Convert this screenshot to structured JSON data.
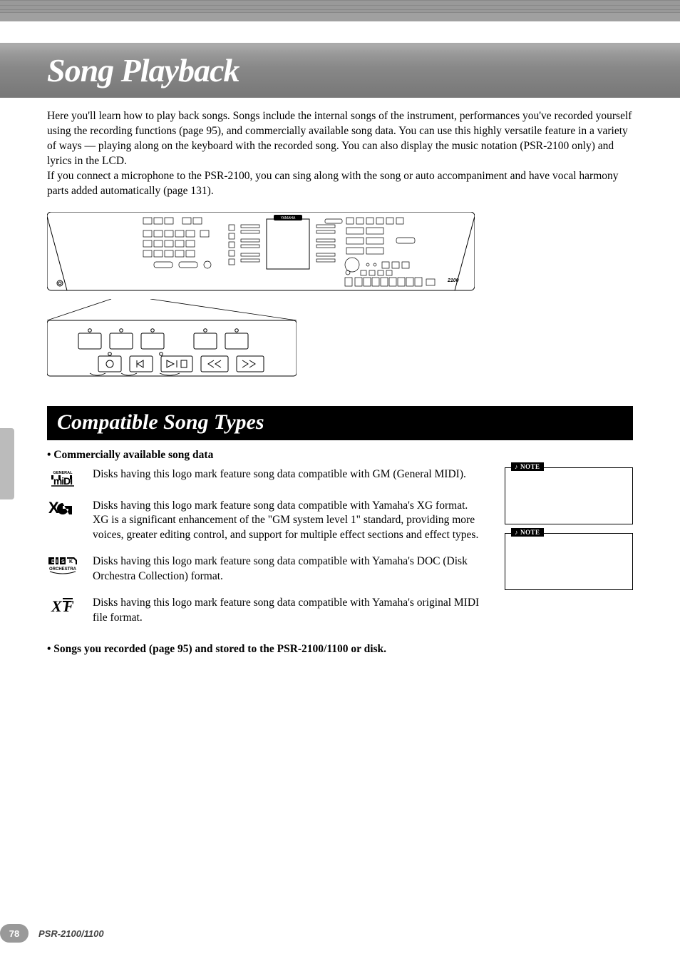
{
  "title": "Song Playback",
  "intro": "Here you'll learn how to play back songs. Songs include the internal songs of the instrument, performances you've recorded yourself using the recording functions (page 95), and commercially available song data. You can use this highly versatile feature in a variety of ways — playing along on the keyboard with the recorded song. You can also display the music notation (PSR-2100 only) and lyrics in the LCD.\nIf you connect a microphone to the PSR-2100, you can sing along with the song or auto accompaniment and have vocal harmony parts added automatically (page 131).",
  "section_title": "Compatible Song Types",
  "bullet1": "• Commercially available song data",
  "logos": {
    "gm": "Disks having this logo mark feature song data compatible with GM (General MIDI).",
    "xg": "Disks having this logo mark feature song data compatible with Yamaha's XG format. XG is a significant enhancement of the \"GM system level 1\" standard, providing more voices, greater editing control, and support for multiple effect sections and effect types.",
    "doc": "Disks having this logo mark feature song data compatible with Yamaha's DOC (Disk Orchestra Collection) format.",
    "xf": "Disks having this logo mark feature song data compatible with Yamaha's original MIDI file format."
  },
  "bullet2": "• Songs you recorded (page 95) and stored to the PSR-2100/1100 or disk.",
  "note_label": "NOTE",
  "footer": {
    "page": "78",
    "model": "PSR-2100/1100"
  }
}
